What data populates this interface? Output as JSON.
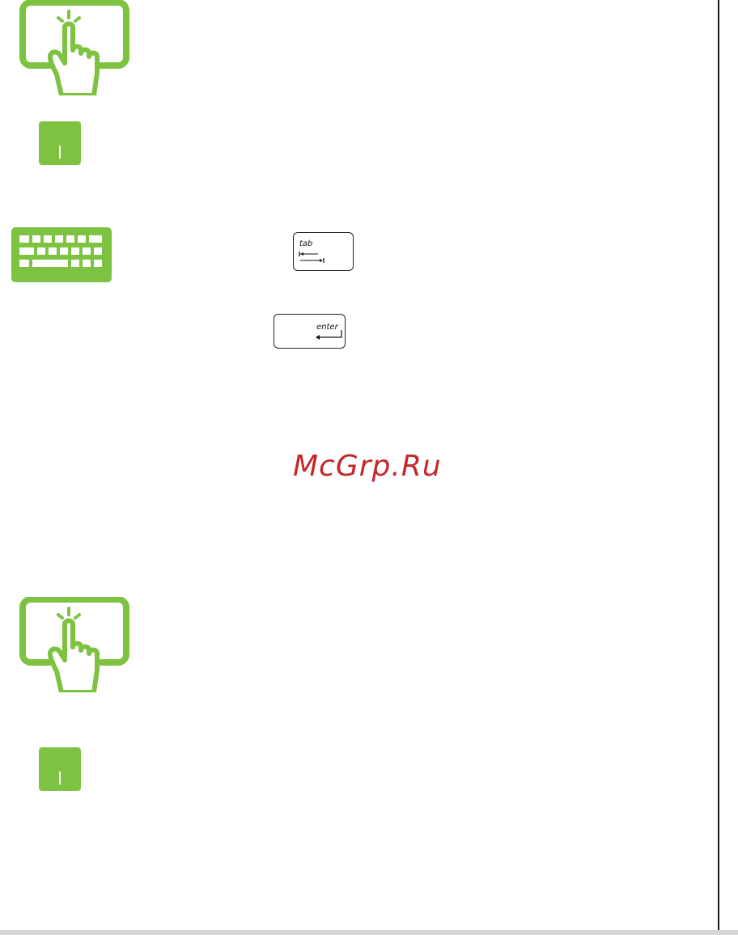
{
  "keys": {
    "tab_label": "tab",
    "enter_label": "enter"
  },
  "watermark": {
    "text": "McGrp.Ru"
  },
  "colors": {
    "icon_green": "#7ec242",
    "watermark_red": "#c4262b"
  },
  "icons": {
    "touch_top": "touchscreen-tap-icon",
    "touchpad_top": "touchpad-icon",
    "keyboard": "keyboard-icon",
    "touch_bottom": "touchscreen-tap-icon",
    "touchpad_bottom": "touchpad-icon"
  }
}
